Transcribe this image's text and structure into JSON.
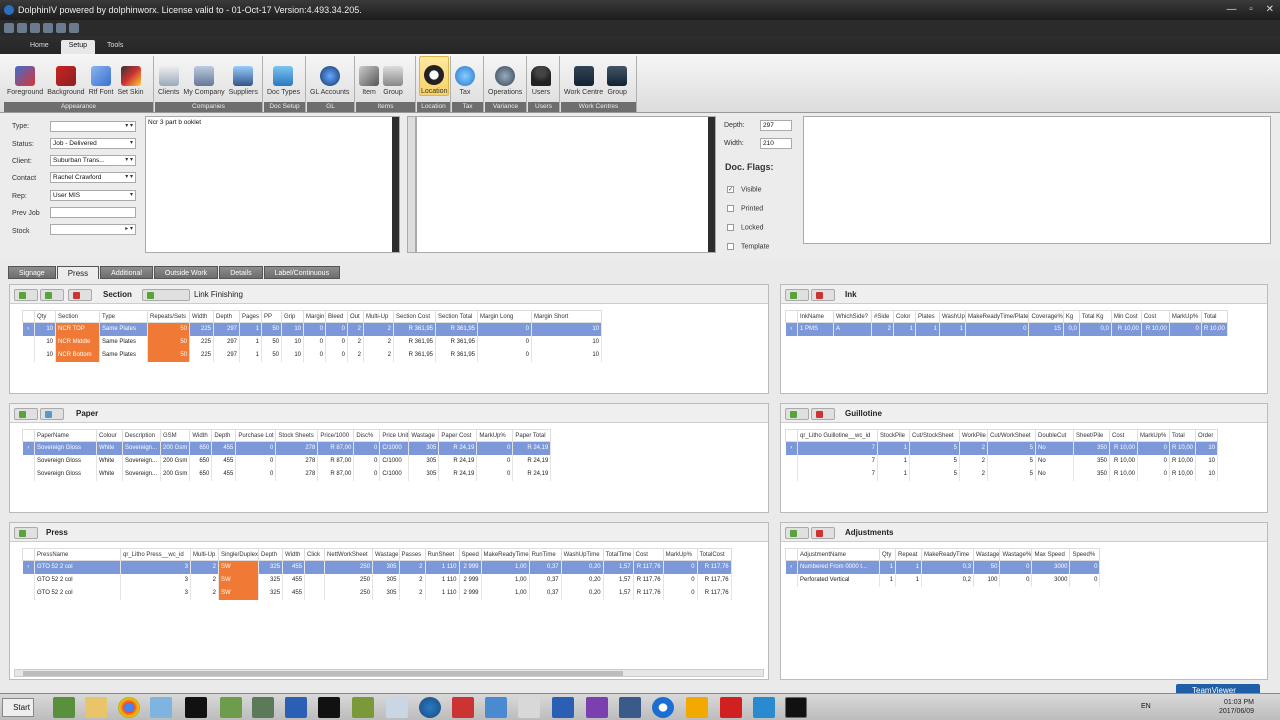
{
  "titlebar": {
    "title": "DolphinIV powered by dolphinworx.  License valid to - 01-Oct-17     Version:4.493.34.205."
  },
  "ribbon_tabs": [
    "Home",
    "Setup",
    "Tools"
  ],
  "ribbon_groups": [
    {
      "label": "Appearance",
      "buttons": [
        "Foreground",
        "Background",
        "Rtf Font",
        "Set Skin"
      ]
    },
    {
      "label": "Companies",
      "buttons": [
        "Clients",
        "My Company",
        "Suppliers"
      ]
    },
    {
      "label": "Doc Setup",
      "buttons": [
        "Doc Types"
      ]
    },
    {
      "label": "GL",
      "buttons": [
        "GL Accounts"
      ]
    },
    {
      "label": "Items",
      "buttons": [
        "Item",
        "Group"
      ]
    },
    {
      "label": "Location",
      "buttons": [
        "Location"
      ]
    },
    {
      "label": "Tax",
      "buttons": [
        "Tax"
      ]
    },
    {
      "label": "Variance",
      "buttons": [
        "Operations"
      ]
    },
    {
      "label": "Users",
      "buttons": [
        "Users"
      ]
    },
    {
      "label": "Work Centres",
      "buttons": [
        "Work Centre",
        "Group"
      ]
    }
  ],
  "form": {
    "type_label": "Type:",
    "type_value": "",
    "status_label": "Status:",
    "status_value": "Job - Delivered",
    "client_label": "Client:",
    "client_value": "Suburban Trans...",
    "contact_label": "Contact",
    "contact_value": "Rachel  Crawford",
    "rep_label": "Rep:",
    "rep_value": "User MIS",
    "prevjob_label": "Prev Job",
    "prevjob_value": "",
    "stock_label": "Stock",
    "stock_value": "",
    "description": "Ncr 3 part b ooklet",
    "depth_label": "Depth:",
    "depth_value": "297",
    "width_label": "Width:",
    "width_value": "210",
    "flags_title": "Doc. Flags:",
    "flags": [
      {
        "label": "Visible",
        "checked": "✓"
      },
      {
        "label": "Printed",
        "checked": ""
      },
      {
        "label": "Locked",
        "checked": ""
      },
      {
        "label": "Template",
        "checked": ""
      }
    ]
  },
  "section_tabs": [
    "Signage",
    "Press",
    "Additional",
    "Outside Work",
    "Details",
    "Label/Continuous"
  ],
  "section_panel": {
    "title": "Section",
    "extra": "Link Finishing",
    "columns": [
      "Qty",
      "Section",
      "Type",
      "Repeats/Sets",
      "Width",
      "Depth",
      "Pages",
      "PP",
      "Grip",
      "Margin",
      "Bleed",
      "Out",
      "Multi-Up",
      "Section Cost",
      "Section Total",
      "Margin Long",
      "Margin Short"
    ],
    "rows": [
      [
        "10",
        "NCR TOP",
        "Same Plates",
        "50",
        "225",
        "297",
        "1",
        "50",
        "10",
        "0",
        "0",
        "2",
        "2",
        "R 361,95",
        "R 361,95",
        "0",
        "10"
      ],
      [
        "10",
        "NCR Middle",
        "Same Plates",
        "50",
        "225",
        "297",
        "1",
        "50",
        "10",
        "0",
        "0",
        "2",
        "2",
        "R 361,95",
        "R 361,95",
        "0",
        "10"
      ],
      [
        "10",
        "NCR Bottom",
        "Same Plates",
        "50",
        "225",
        "297",
        "1",
        "50",
        "10",
        "0",
        "0",
        "2",
        "2",
        "R 361,95",
        "R 361,95",
        "0",
        "10"
      ]
    ]
  },
  "ink_panel": {
    "title": "Ink",
    "columns": [
      "InkName",
      "WhichSide?",
      "#Side",
      "Color",
      "Plates",
      "WashUp",
      "MakeReadyTime/Plate",
      "Coverage%",
      "Kg",
      "Total Kg",
      "Min Cost",
      "Cost",
      "MarkUp%",
      "Total"
    ],
    "rows": [
      [
        "1 PMS",
        "A",
        "2",
        "1",
        "1",
        "1",
        "0",
        "15",
        "0,0",
        "0,0",
        "R 10,00",
        "R 10,00",
        "0",
        "R 10,00"
      ]
    ]
  },
  "paper_panel": {
    "title": "Paper",
    "columns": [
      "PaperName",
      "Colour",
      "Description",
      "GSM",
      "Width",
      "Depth",
      "Purchase Lot",
      "Stock Sheets",
      "Price/1000",
      "Disc%",
      "Price Unit",
      "Wastage",
      "Paper Cost",
      "MarkUp%",
      "Paper Total"
    ],
    "rows": [
      [
        "Sovereign Gloss",
        "White",
        "Sovereign...",
        "200 Gsm",
        "650",
        "455",
        "0",
        "278",
        "R 87,00",
        "0",
        "C/1000",
        "305",
        "R 24,19",
        "0",
        "R 24,19"
      ],
      [
        "Sovereign Gloss",
        "White",
        "Sovereign...",
        "200 Gsm",
        "650",
        "455",
        "0",
        "278",
        "R 87,00",
        "0",
        "C/1000",
        "305",
        "R 24,19",
        "0",
        "R 24,19"
      ],
      [
        "Sovereign Gloss",
        "White",
        "Sovereign...",
        "200 Gsm",
        "650",
        "455",
        "0",
        "278",
        "R 87,00",
        "0",
        "C/1000",
        "305",
        "R 24,19",
        "0",
        "R 24,19"
      ]
    ]
  },
  "guillotine_panel": {
    "title": "Guillotine",
    "columns": [
      "qr_Litho Guillotine__wc_id",
      "StockPile",
      "Cut/StockSheet",
      "WorkPile",
      "Cut/WorkSheet",
      "DoubleCut",
      "Sheet/Pile",
      "Cost",
      "MarkUp%",
      "Total",
      "Order"
    ],
    "rows": [
      [
        "7",
        "1",
        "5",
        "2",
        "5",
        "No",
        "350",
        "R 10,00",
        "0",
        "R 10,00",
        "10"
      ],
      [
        "7",
        "1",
        "5",
        "2",
        "5",
        "No",
        "350",
        "R 10,00",
        "0",
        "R 10,00",
        "10"
      ],
      [
        "7",
        "1",
        "5",
        "2",
        "5",
        "No",
        "350",
        "R 10,00",
        "0",
        "R 10,00",
        "10"
      ]
    ]
  },
  "press_panel": {
    "title": "Press",
    "columns": [
      "PressName",
      "qr_Litho Press__wc_id",
      "Multi-Up",
      "Single/Duplex",
      "Depth",
      "Width",
      "Click",
      "NettWorkSheet",
      "Wastage",
      "Passes",
      "RunSheet",
      "Speed",
      "MakeReadyTime",
      "RunTime",
      "WashUpTime",
      "TotalTime",
      "Cost",
      "MarkUp%",
      "TotalCost"
    ],
    "rows": [
      [
        "GTO 52 2 col",
        "3",
        "2",
        "SW",
        "325",
        "455",
        "",
        "250",
        "305",
        "2",
        "1 110",
        "2 999",
        "1,00",
        "0,37",
        "0,20",
        "1,57",
        "R 117,76",
        "0",
        "R 117,76"
      ],
      [
        "GTO 52 2 col",
        "3",
        "2",
        "SW",
        "325",
        "455",
        "",
        "250",
        "305",
        "2",
        "1 110",
        "2 999",
        "1,00",
        "0,37",
        "0,20",
        "1,57",
        "R 117,76",
        "0",
        "R 117,76"
      ],
      [
        "GTO 52 2 col",
        "3",
        "2",
        "SW",
        "325",
        "455",
        "",
        "250",
        "305",
        "2",
        "1 110",
        "2 999",
        "1,00",
        "0,37",
        "0,20",
        "1,57",
        "R 117,76",
        "0",
        "R 117,76"
      ]
    ]
  },
  "adjust_panel": {
    "title": "Adjustments",
    "columns": [
      "AdjustmentName",
      "Qty",
      "Repeat",
      "MakeReadyTime",
      "Wastage",
      "Wastage%",
      "Max Speed",
      "Speed%"
    ],
    "rows": [
      [
        "Numbered From 0000 t...",
        "1",
        "1",
        "0,3",
        "50",
        "0",
        "3000",
        "0"
      ],
      [
        "Perforated Vertical",
        "1",
        "1",
        "0,2",
        "100",
        "0",
        "3000",
        "0"
      ]
    ]
  },
  "taskbar": {
    "start": "Start",
    "lang": "EN",
    "time": "01:03 PM",
    "date": "2017/06/09",
    "teamviewer": "TeamViewer"
  }
}
